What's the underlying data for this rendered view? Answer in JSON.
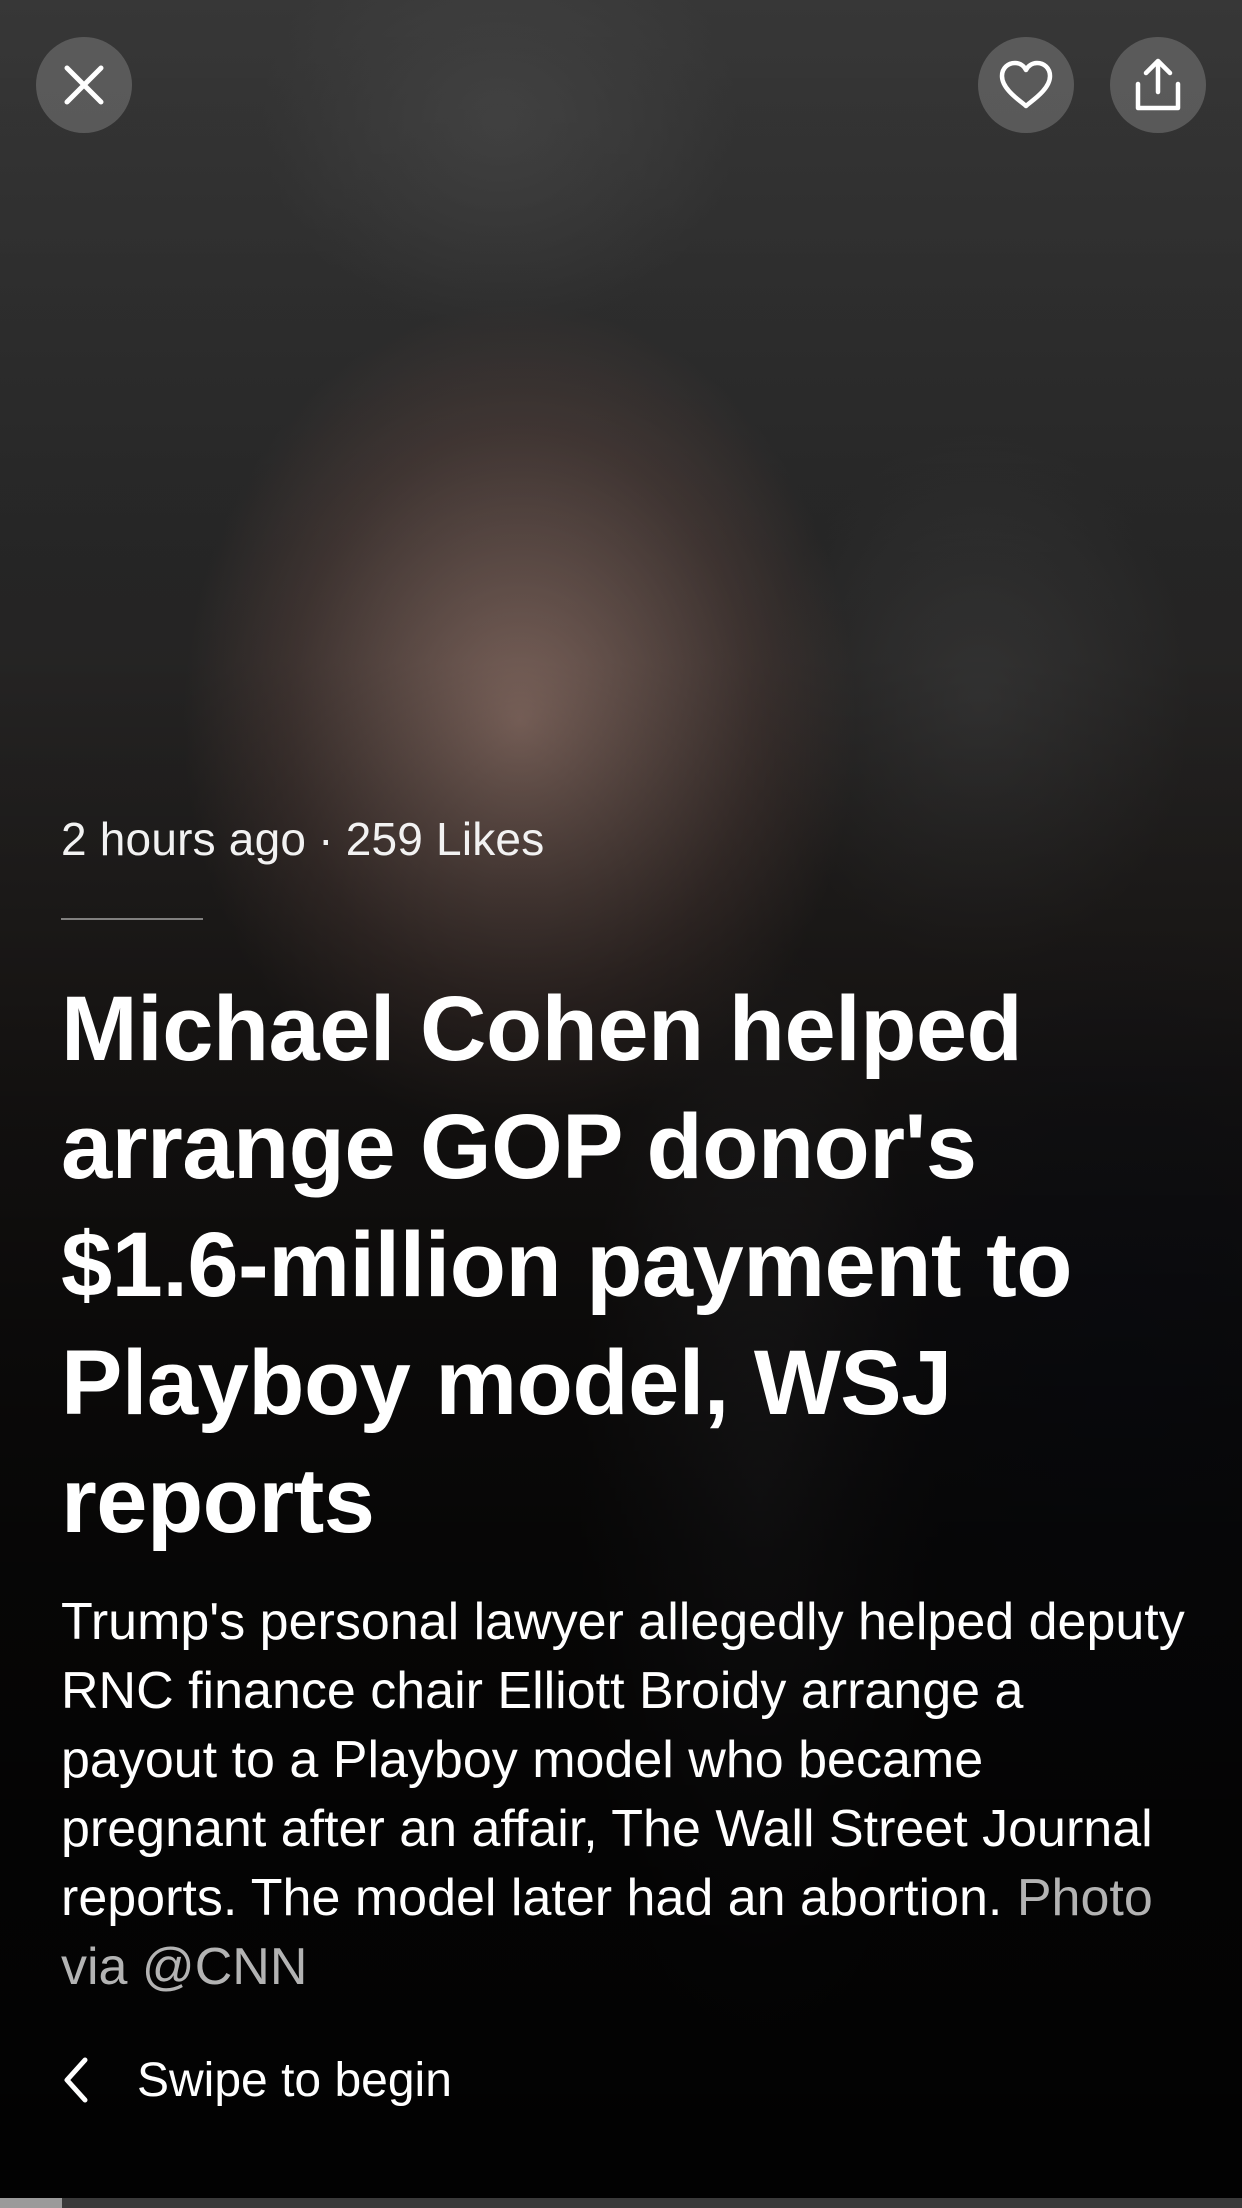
{
  "story": {
    "meta": {
      "time": "2 hours ago",
      "separator": "·",
      "likes": "259 Likes"
    },
    "headline": "Michael Cohen helped arrange GOP donor's $1.6-million payment to Playboy model, WSJ reports",
    "summary": "Trump's personal lawyer allegedly helped deputy RNC finance chair Elliott Broidy arrange a payout to a Playboy model who became pregnant after an affair, The Wall Street Journal reports. The model later had an abortion.",
    "photo_credit": "Photo via @CNN"
  },
  "controls": {
    "close_icon": "close-icon",
    "like_icon": "heart-icon",
    "share_icon": "share-icon",
    "swipe_icon": "chevron-left-icon",
    "swipe_label": "Swipe to begin"
  },
  "progress": {
    "fraction": 0.05
  },
  "colors": {
    "button_bg": "#6e6e6e",
    "text": "#ffffff",
    "credit": "#b3b3b3"
  }
}
